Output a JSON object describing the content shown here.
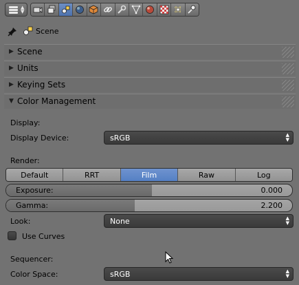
{
  "toolbar": {
    "context_buttons": [
      {
        "icon": "render-camera-icon",
        "active": false
      },
      {
        "icon": "render-layers-icon",
        "active": false
      },
      {
        "icon": "scene-icon",
        "active": true
      },
      {
        "icon": "world-icon",
        "active": false
      },
      {
        "icon": "object-icon",
        "active": false
      },
      {
        "icon": "constraints-icon",
        "active": false
      },
      {
        "icon": "modifiers-wrench-icon",
        "active": false
      },
      {
        "icon": "object-data-mesh-icon",
        "active": false
      },
      {
        "icon": "material-icon",
        "active": false
      },
      {
        "icon": "texture-checker-icon",
        "active": false
      },
      {
        "icon": "particles-icon",
        "active": false
      },
      {
        "icon": "physics-icon",
        "active": false
      }
    ]
  },
  "header": {
    "path": "Scene"
  },
  "panels": {
    "scene": "Scene",
    "units": "Units",
    "keying_sets": "Keying Sets",
    "color_management": "Color Management"
  },
  "color_management": {
    "display_heading": "Display:",
    "display_device_label": "Display Device:",
    "display_device_value": "sRGB",
    "render_heading": "Render:",
    "view_transforms": [
      "Default",
      "RRT",
      "Film",
      "Raw",
      "Log"
    ],
    "view_transform_selected": "Film",
    "exposure_label": "Exposure:",
    "exposure_value": "0.000",
    "exposure_fill_fraction": 0.51,
    "gamma_label": "Gamma:",
    "gamma_value": "2.200",
    "gamma_fill_fraction": 0.45,
    "look_label": "Look:",
    "look_value": "None",
    "use_curves_label": "Use Curves",
    "use_curves_checked": false,
    "sequencer_heading": "Sequencer:",
    "color_space_label": "Color Space:",
    "color_space_value": "sRGB"
  },
  "colors": {
    "background": "#727272",
    "active_blue": "#5580c4",
    "dropdown": "#3f3f3f"
  }
}
